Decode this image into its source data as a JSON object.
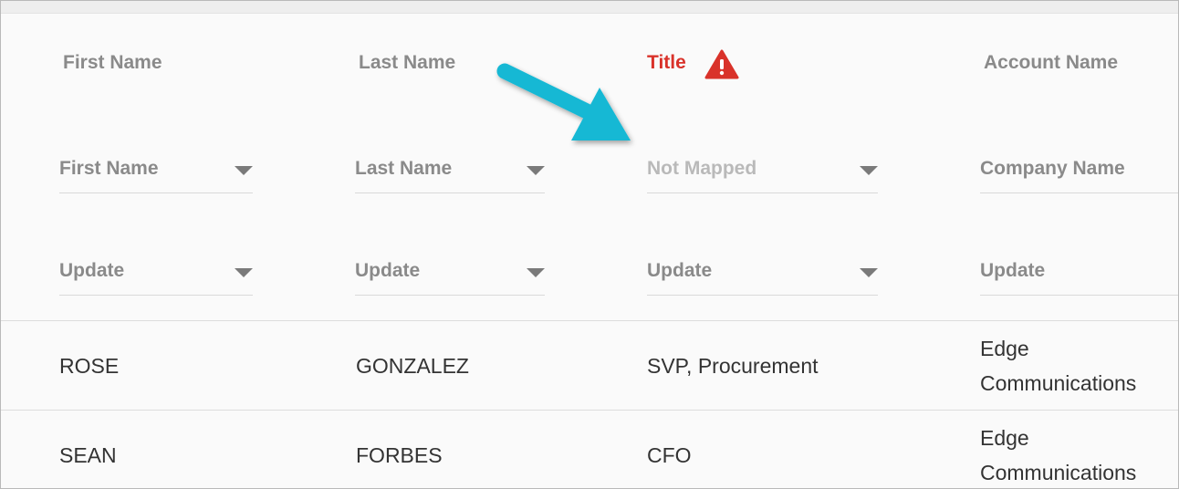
{
  "columns": [
    {
      "header": "First Name",
      "mapping": "First Name",
      "action": "Update"
    },
    {
      "header": "Last Name",
      "mapping": "Last Name",
      "action": "Update"
    },
    {
      "header": "Title",
      "mapping": "Not Mapped",
      "action": "Update",
      "error": true
    },
    {
      "header": "Account Name",
      "mapping": "Company Name",
      "action": "Update"
    }
  ],
  "rows": [
    {
      "first": "ROSE",
      "last": "GONZALEZ",
      "title": "SVP, Procurement",
      "account": "Edge Communications"
    },
    {
      "first": "SEAN",
      "last": "FORBES",
      "title": "CFO",
      "account": "Edge Communications"
    }
  ],
  "colors": {
    "error": "#d9322a",
    "arrow": "#17b8d4",
    "muted_text": "#8a8a8a"
  },
  "icons": {
    "warning": "warning-triangle-icon",
    "dropdown": "chevron-down-icon",
    "callout": "arrow-callout"
  }
}
